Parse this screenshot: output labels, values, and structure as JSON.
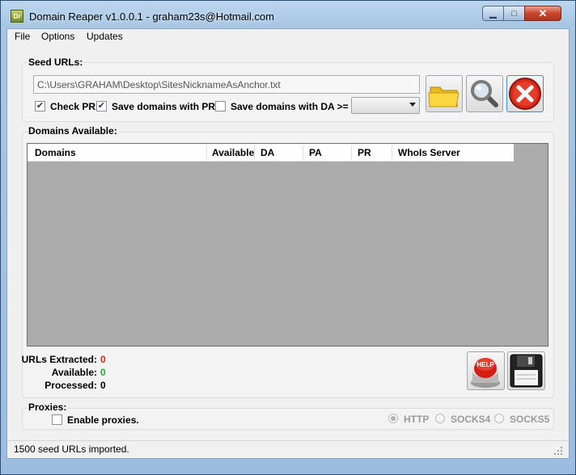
{
  "window": {
    "title": "Domain Reaper v1.0.0.1 - graham23s@Hotmail.com",
    "app_icon_text": "Dr"
  },
  "caption_buttons": {
    "minimize": "▁",
    "maximize": "□",
    "close": "✕"
  },
  "menu": [
    "File",
    "Options",
    "Updates"
  ],
  "seed": {
    "group_label": "Seed URLs:",
    "path": "C:\\Users\\GRAHAM\\Desktop\\SitesNicknameAsAnchor.txt",
    "check_pr": {
      "label": "Check PR.",
      "checked": true
    },
    "save_pr": {
      "label": "Save domains with PR.",
      "checked": true
    },
    "save_da": {
      "label": "Save domains with DA >=",
      "checked": false
    },
    "da_value": "",
    "buttons": {
      "open": "folder-icon",
      "search": "magnifier-icon",
      "stop": "stop-icon"
    }
  },
  "domains": {
    "group_label": "Domains Available:",
    "columns": [
      "Domains",
      "Available",
      "DA",
      "PA",
      "PR",
      "WhoIs Server"
    ],
    "rows": []
  },
  "stats": {
    "urls_extracted_label": "URLs Extracted:",
    "urls_extracted": "0",
    "available_label": "Available:",
    "available": "0",
    "processed_label": "Processed:",
    "processed": "0",
    "colors": {
      "extracted": "#e02020",
      "available": "#22aa22",
      "processed": "#000000"
    },
    "help_label": "HELP"
  },
  "proxies": {
    "group_label": "Proxies:",
    "enable": {
      "label": "Enable proxies.",
      "checked": false
    },
    "types": [
      {
        "label": "HTTP",
        "selected": true
      },
      {
        "label": "SOCKS4",
        "selected": false
      },
      {
        "label": "SOCKS5",
        "selected": false
      }
    ]
  },
  "status": {
    "text": "1500 seed URLs imported."
  }
}
